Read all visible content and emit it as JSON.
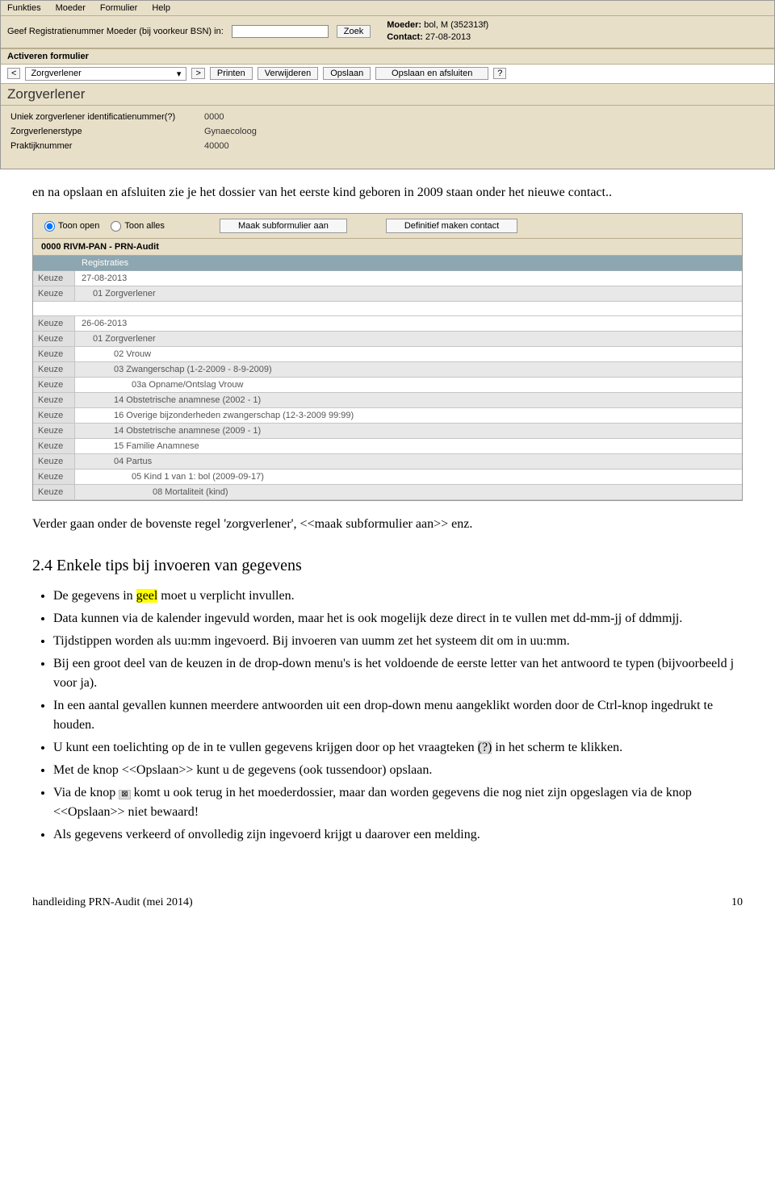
{
  "menubar": [
    "Funkties",
    "Moeder",
    "Formulier",
    "Help"
  ],
  "search": {
    "label": "Geef Registratienummer Moeder (bij voorkeur BSN) in:",
    "button": "Zoek",
    "value": ""
  },
  "info": {
    "moeder_label": "Moeder:",
    "moeder_value": "bol, M (352313f)",
    "contact_label": "Contact:",
    "contact_value": "27-08-2013"
  },
  "panel_header": "Activeren formulier",
  "toolbar": {
    "prev": "<",
    "dropdown": "Zorgverlener",
    "next": ">",
    "print": "Printen",
    "delete": "Verwijderen",
    "save": "Opslaan",
    "save_close": "Opslaan en afsluiten",
    "help": "?"
  },
  "form_title": "Zorgverlener",
  "form_rows": [
    {
      "label": "Uniek zorgverlener identificatienummer(?)",
      "value": "0000"
    },
    {
      "label": "Zorgverlenerstype",
      "value": "Gynaecoloog"
    },
    {
      "label": "Praktijknummer",
      "value": "40000"
    }
  ],
  "para1": "en na opslaan en afsluiten zie je het dossier van het eerste kind geboren in 2009 staan onder het nieuwe contact..",
  "radiobar": {
    "open": "Toon open",
    "alles": "Toon alles",
    "maak": "Maak subformulier aan",
    "def": "Definitief maken contact"
  },
  "bold_row": "0000 RIVM-PAN - PRN-Audit",
  "grid_header": "Registraties",
  "grid_rows": [
    {
      "k": "Keuze",
      "v": "27-08-2013",
      "indent": 0,
      "striped": false
    },
    {
      "k": "Keuze",
      "v": "01 Zorgverlener",
      "indent": 1,
      "striped": true
    },
    {
      "k": "",
      "v": "",
      "indent": 0,
      "striped": false,
      "blank": true
    },
    {
      "k": "Keuze",
      "v": "26-06-2013",
      "indent": 0,
      "striped": false
    },
    {
      "k": "Keuze",
      "v": "01 Zorgverlener",
      "indent": 1,
      "striped": true
    },
    {
      "k": "Keuze",
      "v": "02 Vrouw",
      "indent": 2,
      "striped": false
    },
    {
      "k": "Keuze",
      "v": "03 Zwangerschap (1-2-2009 - 8-9-2009)",
      "indent": 2,
      "striped": true
    },
    {
      "k": "Keuze",
      "v": "03a Opname/Ontslag Vrouw",
      "indent": 3,
      "striped": false
    },
    {
      "k": "Keuze",
      "v": "14 Obstetrische anamnese (2002 - 1)",
      "indent": 2,
      "striped": true
    },
    {
      "k": "Keuze",
      "v": "16 Overige bijzonderheden zwangerschap (12-3-2009 99:99)",
      "indent": 2,
      "striped": false
    },
    {
      "k": "Keuze",
      "v": "14 Obstetrische anamnese (2009 - 1)",
      "indent": 2,
      "striped": true
    },
    {
      "k": "Keuze",
      "v": "15 Familie Anamnese",
      "indent": 2,
      "striped": false
    },
    {
      "k": "Keuze",
      "v": "04 Partus",
      "indent": 2,
      "striped": true
    },
    {
      "k": "Keuze",
      "v": "05 Kind 1 van 1: bol (2009-09-17)",
      "indent": 3,
      "striped": false
    },
    {
      "k": "Keuze",
      "v": "08 Mortaliteit (kind)",
      "indent": 4,
      "striped": true
    }
  ],
  "para2": "Verder gaan onder de bovenste regel 'zorgverlener', <<maak subformulier aan>> enz.",
  "section_title": "2.4  Enkele tips bij invoeren van gegevens",
  "tips": [
    {
      "pre": "De gegevens in ",
      "hl": "geel",
      "post": " moet u verplicht invullen."
    },
    {
      "text": "Data kunnen via de kalender ingevuld worden, maar het is ook mogelijk deze direct in te vullen met dd-mm-jj of ddmmjj."
    },
    {
      "text": "Tijdstippen worden als uu:mm ingevoerd. Bij invoeren van uumm zet het systeem dit om in uu:mm."
    },
    {
      "text": "Bij een groot deel van de keuzen in de drop-down menu's is het voldoende de eerste letter van het antwoord te typen (bijvoorbeeld j voor ja)."
    },
    {
      "text": "In een aantal gevallen kunnen meerdere antwoorden uit een drop-down menu aangeklikt worden door de Ctrl-knop ingedrukt te houden."
    },
    {
      "pre2": "U kunt een toelichting op de in te vullen gegevens krijgen door op het vraagteken ",
      "box": "(?)",
      "post2": " in het scherm te klikken."
    },
    {
      "text": "Met de knop <<Opslaan>>  kunt u de gegevens (ook tussendoor) opslaan."
    },
    {
      "pre3": "Via de knop ",
      "icon": "⊠",
      "post3": " komt u ook terug in het moederdossier, maar dan worden gegevens die nog niet zijn opgeslagen via de knop <<Opslaan>>  niet bewaard!"
    },
    {
      "text": "Als gegevens verkeerd of onvolledig zijn ingevoerd krijgt u daarover een melding."
    }
  ],
  "footer": {
    "left": "handleiding PRN-Audit (mei 2014)",
    "right": "10"
  }
}
